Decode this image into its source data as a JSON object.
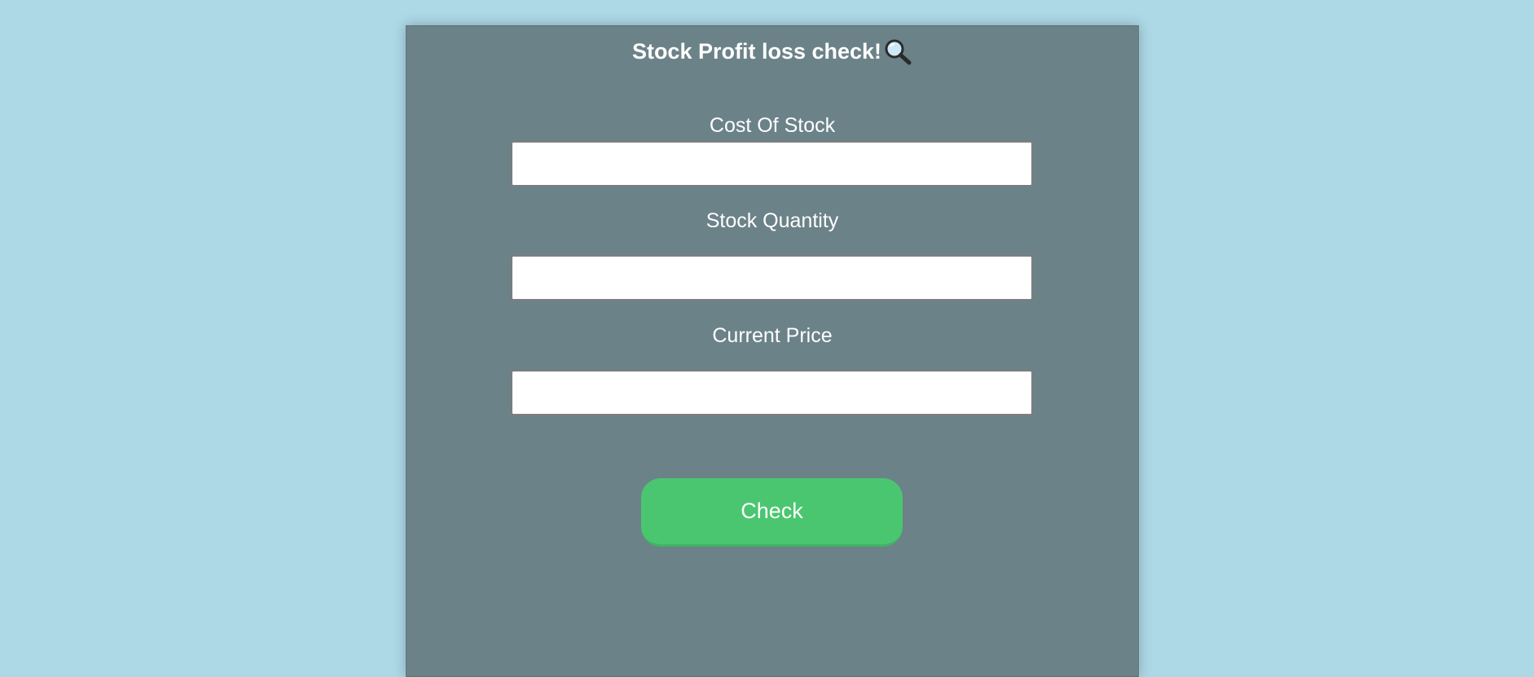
{
  "header": {
    "title": "Stock Profit loss check!",
    "icon": "magnifying-glass-icon"
  },
  "form": {
    "cost_label": "Cost Of Stock",
    "cost_value": "",
    "quantity_label": "Stock Quantity",
    "quantity_value": "",
    "price_label": "Current Price",
    "price_value": "",
    "check_label": "Check"
  },
  "colors": {
    "background": "#add8e6",
    "card": "#6b8288",
    "button": "#4ac670",
    "text": "#ffffff"
  }
}
